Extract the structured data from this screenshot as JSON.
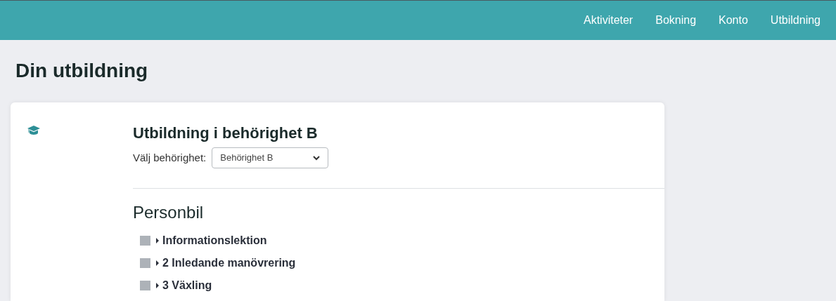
{
  "nav": {
    "items": [
      {
        "label": "Aktiviteter",
        "selected": false
      },
      {
        "label": "Bokning",
        "selected": false
      },
      {
        "label": "Konto",
        "selected": false
      },
      {
        "label": "Utbildning",
        "selected": false
      }
    ]
  },
  "page_title": "Din utbildning",
  "card": {
    "title": "Utbildning i behörighet B",
    "select": {
      "label": "Välj behörighet:",
      "value": "Behörighet B"
    },
    "section": "Personbil",
    "lessons": [
      {
        "label": "Informationslektion",
        "completed": false,
        "expanded": false
      },
      {
        "label": "2 Inledande manövrering",
        "completed": false,
        "expanded": false
      },
      {
        "label": "3 Växling",
        "completed": false,
        "expanded": false
      }
    ]
  }
}
